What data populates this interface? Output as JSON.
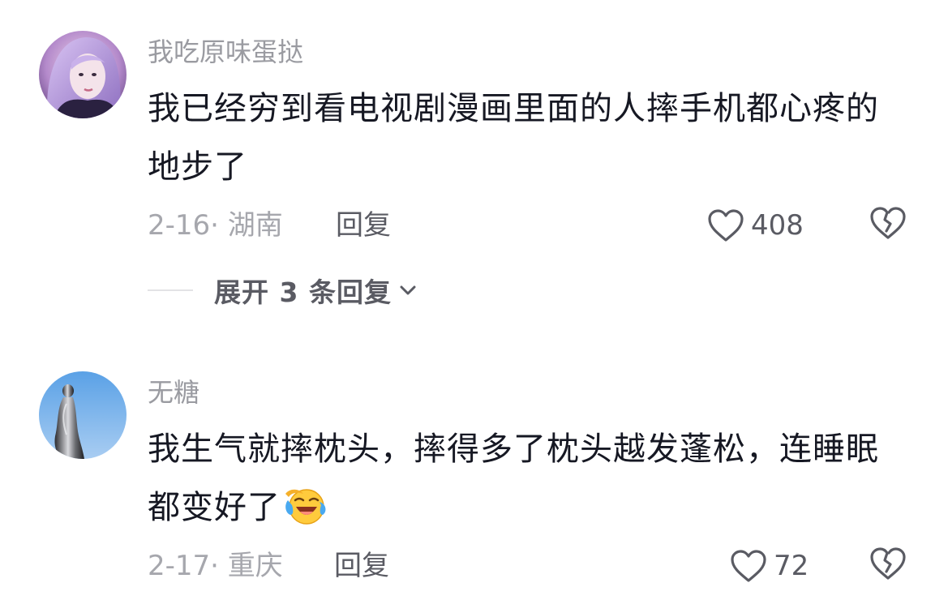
{
  "comments": [
    {
      "username": "我吃原味蛋挞",
      "text": "我已经穷到看电视剧漫画里面的人摔手机都心疼的地步了",
      "date_location": "2-16· 湖南",
      "reply_label": "回复",
      "likes": "408",
      "avatar_icon": "avatar-photo-icon",
      "expand_label": "展开 3 条回复"
    },
    {
      "username": "无糖",
      "text": "我生气就摔枕头，摔得多了枕头越发蓬松，连睡眠都变好了",
      "emoji": "laughing-crying-face-icon",
      "date_location": "2-17· 重庆",
      "reply_label": "回复",
      "likes": "72",
      "avatar_icon": "avatar-photo-icon"
    }
  ],
  "colors": {
    "text_primary": "#161823",
    "text_secondary": "#9a9ba1",
    "action": "#5a5b63",
    "divider": "#e3e3e6"
  },
  "icons": [
    "heart-outline-icon",
    "broken-heart-icon",
    "chevron-down-icon"
  ]
}
